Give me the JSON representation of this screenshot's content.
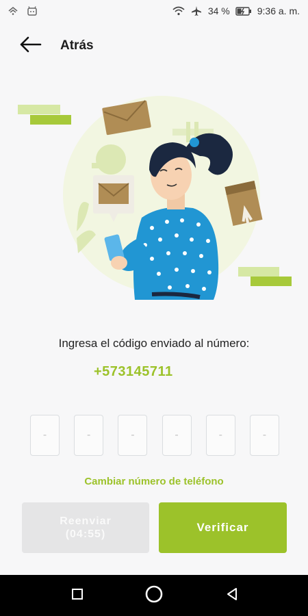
{
  "status_bar": {
    "battery": "34 %",
    "time": "9:36 a. m.",
    "icons": [
      "signal-icon",
      "android-icon",
      "wifi-icon",
      "airplane-icon",
      "battery-icon"
    ]
  },
  "header": {
    "back_label": "Atrás",
    "back_icon": "arrow-left-icon"
  },
  "verification": {
    "instruction": "Ingresa el código enviado al número:",
    "phone": "+573145711",
    "code_placeholder": "-",
    "change_number": "Cambiar número de teléfono"
  },
  "buttons": {
    "resend_label": "Reenviar",
    "resend_timer": "(04:55)",
    "verify_label": "Verificar"
  },
  "colors": {
    "accent": "#9cc22a",
    "disabled": "#e5e5e6",
    "background": "#f7f7f8"
  },
  "nav": {
    "icons": [
      "square-icon",
      "circle-icon",
      "triangle-back-icon"
    ]
  }
}
